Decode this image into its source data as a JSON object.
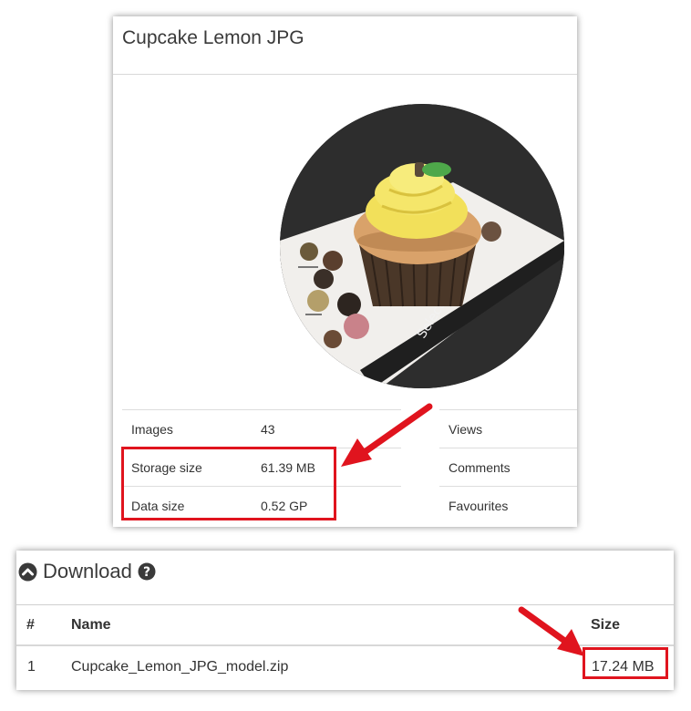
{
  "model": {
    "title": "Cupcake Lemon JPG",
    "thumbnail_icon": "cupcake-photo",
    "stats_left": [
      {
        "label": "Images",
        "value": "43"
      },
      {
        "label": "Storage size",
        "value": "61.39 MB"
      },
      {
        "label": "Data size",
        "value": "0.52 GP"
      }
    ],
    "stats_right": [
      {
        "label": "Views"
      },
      {
        "label": "Comments"
      },
      {
        "label": "Favourites"
      }
    ],
    "thumbnail_text": "Select Range"
  },
  "download": {
    "title": "Download",
    "collapse_icon": "chevron-up-circle-icon",
    "help_icon": "question-circle-icon",
    "columns": {
      "index": "#",
      "name": "Name",
      "size": "Size"
    },
    "rows": [
      {
        "index": "1",
        "name": "Cupcake_Lemon_JPG_model.zip",
        "size": "17.24 MB"
      }
    ]
  },
  "colors": {
    "annotation": "#e0141e",
    "panel_border": "#d8d8d8",
    "thumbnail_bg": "#2d2d2d"
  }
}
